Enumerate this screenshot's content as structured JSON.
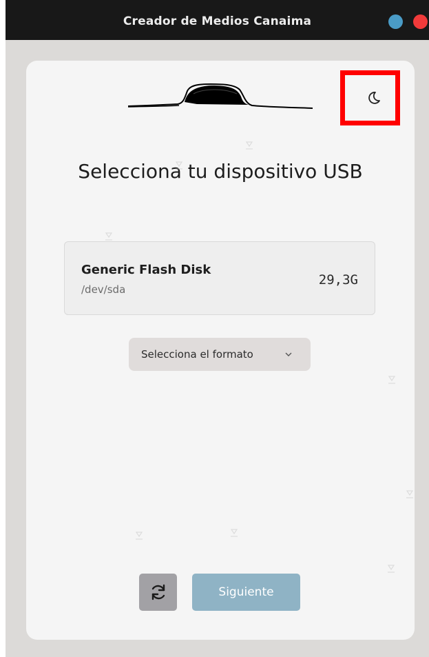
{
  "window": {
    "title": "Creador de Medios Canaima",
    "buttons": [
      {
        "name": "minimize",
        "color": "#4a9cc7"
      },
      {
        "name": "close",
        "color": "#f13a3a"
      }
    ]
  },
  "header": {
    "logo_icon": "tepui-mountain-logo",
    "theme_toggle_icon": "moon-icon"
  },
  "main": {
    "title": "Selecciona tu dispositivo USB",
    "devices": [
      {
        "name": "Generic Flash Disk",
        "path": "/dev/sda",
        "size": "29,3G"
      }
    ],
    "format_select": {
      "label": "Selecciona el formato",
      "icon": "chevron-down-icon"
    }
  },
  "footer": {
    "refresh_icon": "refresh-icon",
    "next_label": "Siguiente"
  },
  "colors": {
    "accent": "#8fb3c5",
    "highlight": "#ff0000",
    "titlebar": "#181818"
  }
}
